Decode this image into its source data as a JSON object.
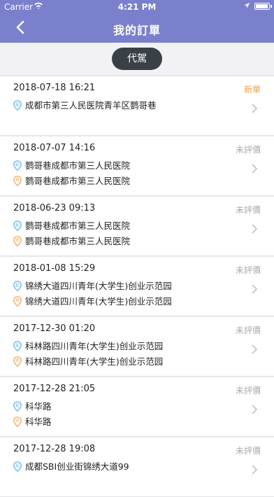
{
  "status_bar": {
    "carrier": "Carrier",
    "time": "4:21 PM"
  },
  "header": {
    "title": "我的訂單"
  },
  "tabs": [
    {
      "label": "代駕",
      "active": true
    }
  ],
  "orders": [
    {
      "datetime": "2018-07-18 16:21",
      "status": "新單",
      "from": "成都市第三人民医院青羊区鹦哥巷",
      "to": ""
    },
    {
      "datetime": "2018-07-07 14:16",
      "status": "未評價",
      "from": "鹦哥巷成都市第三人民医院",
      "to": "鹦哥巷成都市第三人民医院"
    },
    {
      "datetime": "2018-06-23 09:13",
      "status": "未評價",
      "from": "鹦哥巷成都市第三人民医院",
      "to": "鹦哥巷成都市第三人民医院"
    },
    {
      "datetime": "2018-01-08 15:29",
      "status": "未評價",
      "from": "锦绣大道四川青年(大学生)创业示范园",
      "to": "锦绣大道四川青年(大学生)创业示范园"
    },
    {
      "datetime": "2017-12-30 01:20",
      "status": "未評價",
      "from": "科林路四川青年(大学生)创业示范园",
      "to": "科林路四川青年(大学生)创业示范园"
    },
    {
      "datetime": "2017-12-28 21:05",
      "status": "未評價",
      "from": "科华路",
      "to": "科华路"
    },
    {
      "datetime": "2017-12-28 19:08",
      "status": "未評價",
      "from": "成都SBI创业街锦绣大道99",
      "to": ""
    }
  ],
  "colors": {
    "header": "#7a80cc",
    "new_status": "#f0a050",
    "start_pin": "#5ab4e6",
    "end_pin": "#f0a050"
  }
}
